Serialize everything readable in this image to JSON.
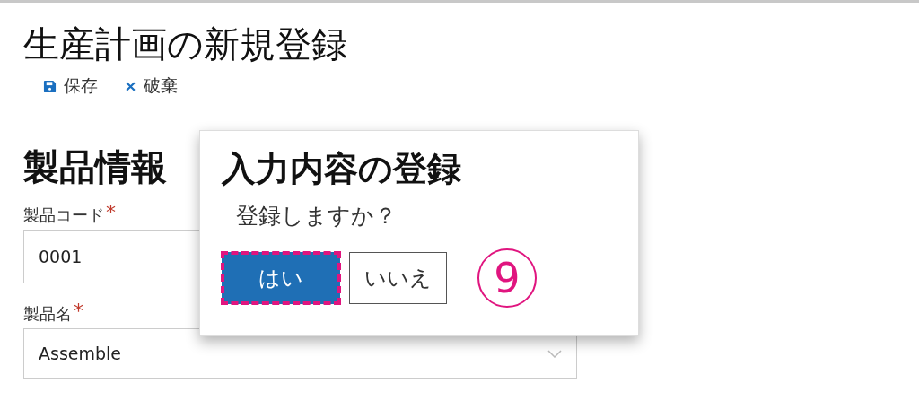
{
  "page": {
    "title": "生産計画の新規登録"
  },
  "toolbar": [
    {
      "kind": "save",
      "label": "保存"
    },
    {
      "kind": "discard",
      "label": "破棄"
    }
  ],
  "section": {
    "title": "製品情報"
  },
  "fields": [
    {
      "kind": "text",
      "label": "製品コード",
      "required_mark": "*",
      "value": "0001"
    },
    {
      "kind": "dropdown",
      "label": "製品名",
      "required_mark": "*",
      "value": "Assemble"
    }
  ],
  "dialog": {
    "title": "入力内容の登録",
    "message": "登録しますか？",
    "buttons": [
      {
        "label": "はい",
        "primary": true,
        "highlighted": true
      },
      {
        "label": "いいえ",
        "primary": false,
        "highlighted": false
      }
    ]
  },
  "annotation": {
    "label": "9"
  }
}
